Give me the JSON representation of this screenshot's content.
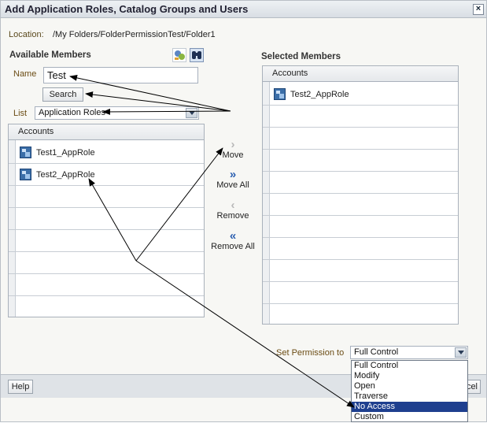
{
  "dialog": {
    "title": "Add Application Roles, Catalog Groups and Users",
    "close_icon": "close-x-icon"
  },
  "location": {
    "label": "Location:",
    "path": "/My Folders/FolderPermissionTest/Folder1"
  },
  "available": {
    "title": "Available Members",
    "icons": [
      "roles-icon",
      "binoculars-icon"
    ],
    "name_label": "Name",
    "name_value": "Test",
    "search_label": "Search",
    "list_label": "List",
    "list_value": "Application Roles",
    "grid_header": "Accounts",
    "rows": [
      "Test1_AppRole",
      "Test2_AppRole"
    ]
  },
  "shuttle": {
    "move": "Move",
    "move_all": "Move All",
    "remove": "Remove",
    "remove_all": "Remove All"
  },
  "selected": {
    "title": "Selected Members",
    "grid_header": "Accounts",
    "rows": [
      "Test2_AppRole"
    ]
  },
  "permission": {
    "label": "Set Permission to",
    "value": "Full Control",
    "options": [
      "Full Control",
      "Modify",
      "Open",
      "Traverse",
      "No Access",
      "Custom"
    ],
    "highlighted": "No Access"
  },
  "footer": {
    "help": "Help",
    "cancel_fragment": "cel"
  },
  "colors": {
    "selection": "#1e3f8f",
    "label": "#6b4c14",
    "role_icon": "#3b6ea8"
  }
}
